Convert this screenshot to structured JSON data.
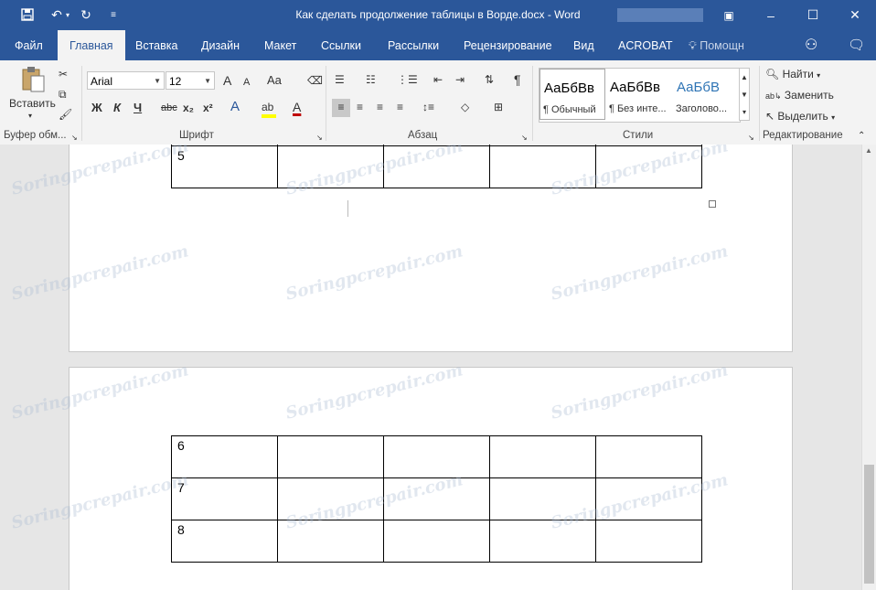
{
  "window": {
    "title": "Как сделать продолжение таблицы в Ворде.docx - Word",
    "controls": {
      "restore_icon": "ribbon-display-icon",
      "minimize": "–",
      "maximize": "☐",
      "close": "✕"
    }
  },
  "quick_access": {
    "save_icon": "save-icon",
    "undo_icon": "undo-icon",
    "redo_icon": "redo-icon",
    "customize_icon": "customize-icon"
  },
  "tabs": [
    "Файл",
    "Главная",
    "Вставка",
    "Дизайн",
    "Макет",
    "Ссылки",
    "Рассылки",
    "Рецензирование",
    "Вид",
    "ACROBAT"
  ],
  "tell_me": "Помощн",
  "ribbon": {
    "clipboard": {
      "paste_label": "Вставить",
      "group_label": "Буфер обм..."
    },
    "font": {
      "name": "Arial",
      "size": "12",
      "bold": "Ж",
      "italic": "К",
      "underline": "Ч",
      "strike": "abc",
      "subscript": "x₂",
      "superscript": "x²",
      "grow": "A",
      "shrink": "A",
      "case": "Aa",
      "group_label": "Шрифт"
    },
    "paragraph": {
      "group_label": "Абзац"
    },
    "styles": {
      "items": [
        {
          "sample": "АаБбВв",
          "name": "¶ Обычный"
        },
        {
          "sample": "АаБбВв",
          "name": "¶ Без инте..."
        },
        {
          "sample": "АаБбВ",
          "name": "Заголово..."
        }
      ],
      "group_label": "Стили"
    },
    "editing": {
      "find": "Найти",
      "replace": "Заменить",
      "select": "Выделить",
      "group_label": "Редактирование"
    }
  },
  "document": {
    "page1_rows": [
      [
        "5",
        "",
        "",
        "",
        ""
      ]
    ],
    "page2_rows": [
      [
        "6",
        "",
        "",
        "",
        ""
      ],
      [
        "7",
        "",
        "",
        "",
        ""
      ],
      [
        "8",
        "",
        "",
        "",
        ""
      ]
    ]
  },
  "watermark": "Soringpcrepair.com",
  "colors": {
    "accent": "#2b579a",
    "highlight": "#ffff00",
    "font_color": "#c00000"
  }
}
